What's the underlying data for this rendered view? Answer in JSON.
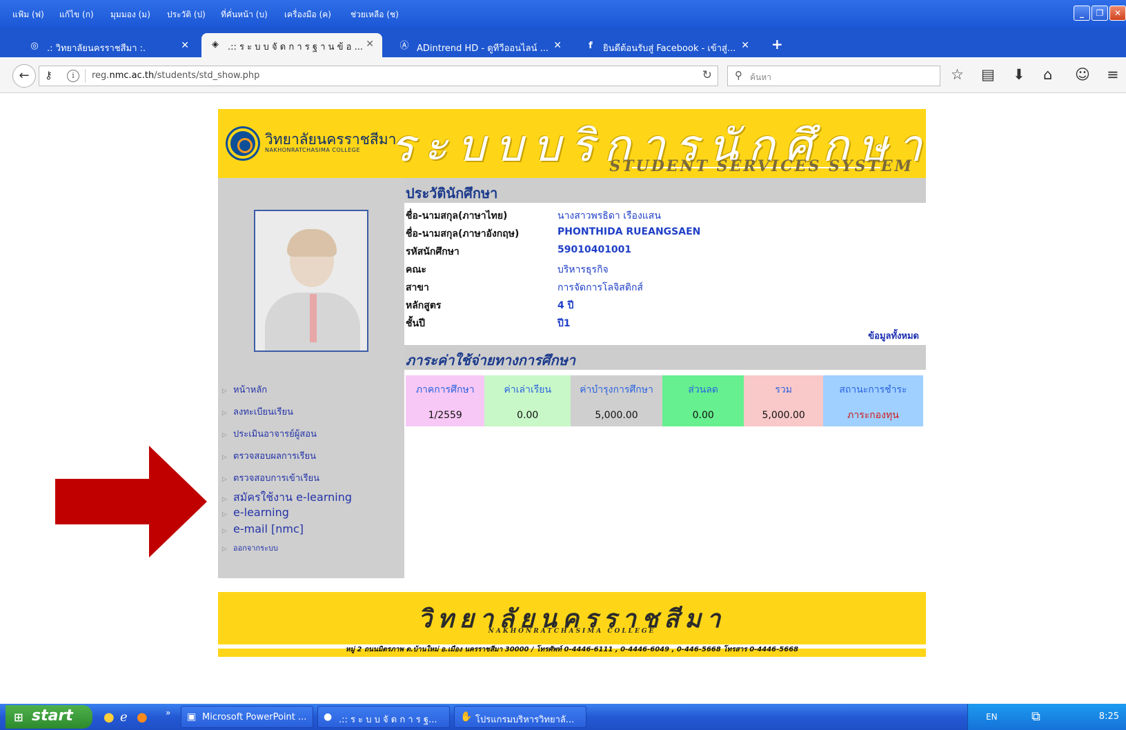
{
  "browser": {
    "menu": [
      "แฟ้ม (ฟ)",
      "แก้ไข (ก)",
      "มุมมอง (ม)",
      "ประวัติ (ป)",
      "ที่คั่นหน้า (บ)",
      "เครื่องมือ (ค)",
      "ช่วยเหลือ (ช)"
    ],
    "tabs": [
      {
        "label": ".: วิทยาลัยนครราชสีมา :.",
        "icon": "college-logo-icon"
      },
      {
        "label": ".:: ร ะ บ บ จั ด ก า ร ฐ า น ข้ อ ...",
        "icon": "college-logo-icon"
      },
      {
        "label": "ADintrend HD - ดูทีวีออนไลน์ ...",
        "icon": "adintrend-icon"
      },
      {
        "label": "ยินดีต้อนรับสู่ Facebook - เข้าสู่...",
        "icon": "facebook-icon"
      }
    ],
    "new_tab": "+",
    "url": {
      "prefix": "reg.",
      "domain": "nmc.ac.th",
      "path": "/students/std_show.php"
    },
    "search_placeholder": "ค้นหา"
  },
  "site": {
    "logo_th": "วิทยาลัยนครราชสีมา",
    "logo_en": "NAKHONRATCHASIMA COLLEGE",
    "banner_title": "ระบบบริการนักศึกษา",
    "banner_subtitle": "STUDENT SERVICES SYSTEM",
    "profile_section_title": "ประวัตินักศึกษา",
    "profile": [
      {
        "label": "ชื่อ-นามสกุล(ภาษาไทย)",
        "value": "นางสาวพรธิดา    เรืองแสน"
      },
      {
        "label": "ชื่อ-นามสกุล(ภาษาอังกฤษ)",
        "value": "PHONTHIDA   RUEANGSAEN"
      },
      {
        "label": "รหัสนักศึกษา",
        "value": "59010401001"
      },
      {
        "label": "คณะ",
        "value": "บริหารธุรกิจ"
      },
      {
        "label": "สาขา",
        "value": "การจัดการโลจิสติกส์"
      },
      {
        "label": "หลักสูตร",
        "value": "4 ปี"
      },
      {
        "label": "ชั้นปี",
        "value": "ปี1"
      }
    ],
    "all_data_link": "ข้อมูลทั้งหมด",
    "fees_section_title": "ภาระค่าใช้จ่ายทางการศึกษา",
    "fee_headers": [
      "ภาคการศึกษา",
      "ค่าเล่าเรียน",
      "ค่าบำรุงการศึกษา",
      "ส่วนลด",
      "รวม",
      "สถานะการชำระ"
    ],
    "fee_rows": [
      [
        "1/2559",
        "0.00",
        "5,000.00",
        "0.00",
        "5,000.00",
        "ภาระกองทุน"
      ]
    ],
    "fee_colors": [
      "#f7c8f5",
      "#c8f7c8",
      "#cfcfcf",
      "#66f08f",
      "#f9c8c8",
      "#9fd0ff"
    ],
    "nav": [
      "หน้าหลัก",
      "ลงทะเบียนเรียน",
      "ประเมินอาจารย์ผู้สอน",
      "ตรวจสอบผลการเรียน",
      "ตรวจสอบการเข้าเรียน",
      "สมัครใช้งาน e-learning",
      "e-learning",
      "e-mail [nmc]",
      "ออกจากระบบ"
    ],
    "footer_title": "วิทยาลัยนครราชสีมา",
    "footer_subtitle": "NAKHONRATCHASIMA COLLEGE",
    "address": "หมู่ 2 ถนนมิตรภาพ ต.บ้านใหม่ อ.เมือง นครราชสีมา 30000 / โทรศัพท์ 0-4446-6111 , 0-4446-6049 , 0-446-5668 โทรสาร 0-4446-5668"
  },
  "annotation": {
    "arrow_color": "#c00000"
  },
  "taskbar": {
    "start": "start",
    "tasks": [
      {
        "label": "Microsoft PowerPoint ...",
        "icon": "powerpoint-icon"
      },
      {
        "label": ".:: ร ะ บ บ จั ด ก า ร ฐ...",
        "icon": "firefox-icon"
      },
      {
        "label": "โปรแกรมบริหารวิทยาลั...",
        "icon": "handshake-icon"
      }
    ],
    "lang": "EN",
    "clock": "8:25"
  }
}
